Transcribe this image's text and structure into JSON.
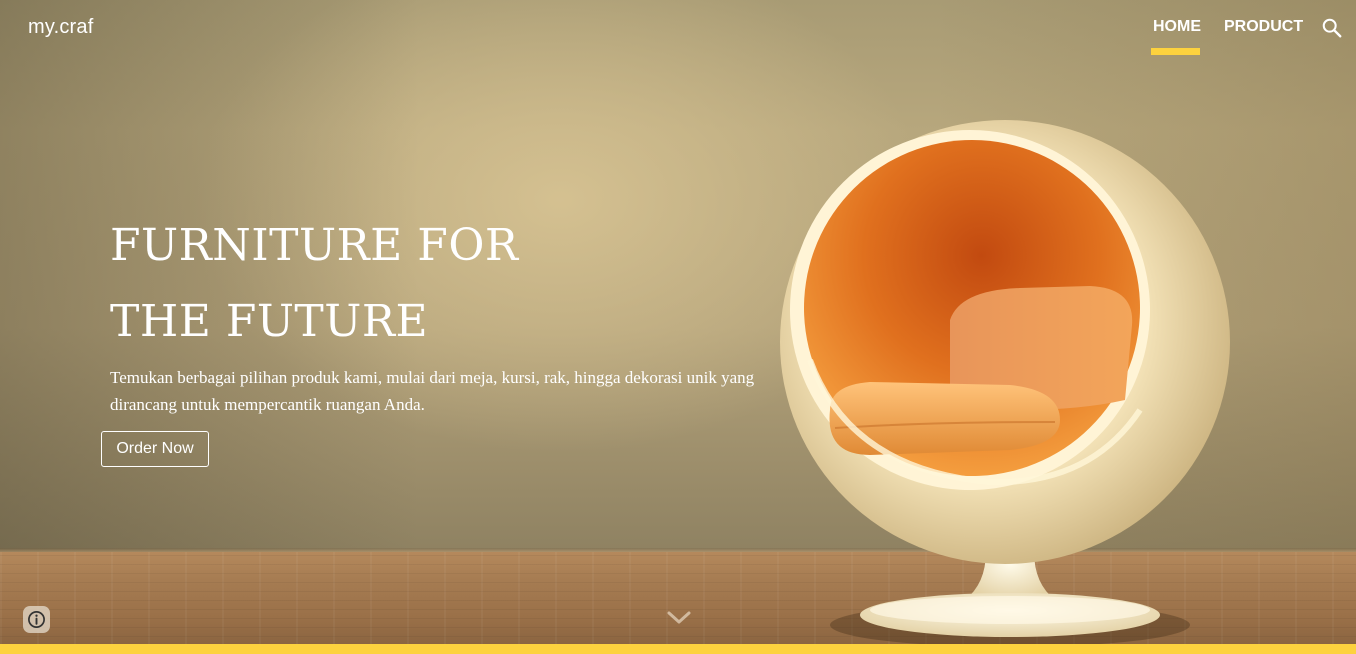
{
  "brand": {
    "logo_text": "my.craf"
  },
  "nav": {
    "items": [
      {
        "label": "HOME",
        "active": true
      },
      {
        "label": "PRODUCT",
        "active": false
      }
    ],
    "search_icon": "search-icon",
    "active_indicator_color": "#fdd23e"
  },
  "hero": {
    "headline_line1": "FURNITURE FOR",
    "headline_line2": "THE FUTURE",
    "description": "Temukan berbagai pilihan produk kami, mulai dari meja, kursi, rak, hingga dekorasi unik yang dirancang untuk mempercantik ruangan Anda.",
    "cta_label": "Order Now",
    "image_subject": "orange ball chair on wooden floor"
  },
  "footer_controls": {
    "info_icon": "info-icon",
    "scroll_icon": "chevron-down-icon"
  },
  "colors": {
    "accent": "#fdd23e",
    "text": "#ffffff"
  }
}
